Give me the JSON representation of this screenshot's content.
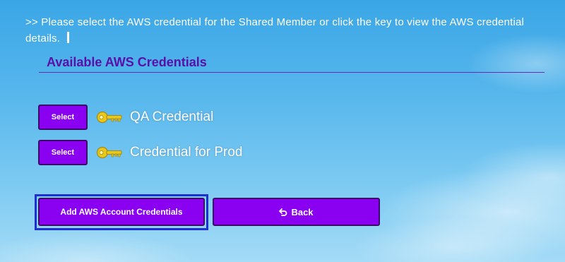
{
  "instruction": {
    "text": ">> Please select the AWS credential for the Shared Member or click the key to view the AWS credential details."
  },
  "section": {
    "title": "Available AWS Credentials"
  },
  "credentials": [
    {
      "select_label": "Select",
      "name": "QA Credential",
      "icon": "key-icon"
    },
    {
      "select_label": "Select",
      "name": "Credential for Prod",
      "icon": "key-icon"
    }
  ],
  "actions": {
    "add_label": "Add AWS Account Credentials",
    "back_label": "Back",
    "back_icon": "undo-arrow-icon"
  },
  "colors": {
    "accent": "#8a00f0",
    "title": "#5a10a8",
    "focus": "#1f2fd6",
    "key": "#e8c81a"
  }
}
